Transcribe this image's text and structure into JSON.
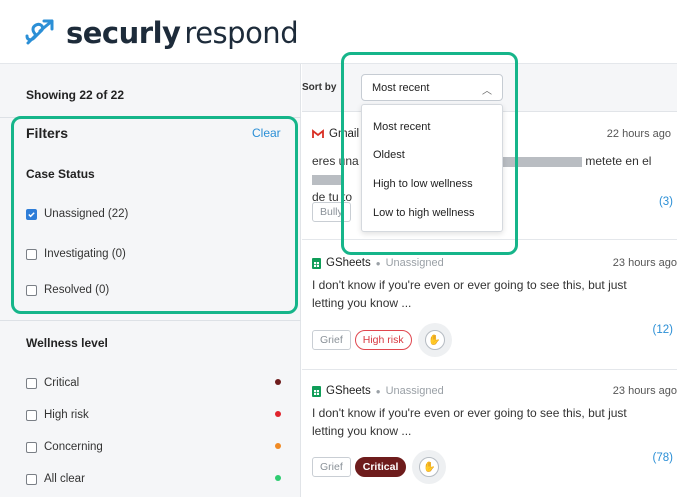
{
  "brand": {
    "word1": "securly",
    "word2": "respond"
  },
  "sidebar": {
    "showing": "Showing 22 of 22",
    "filters_title": "Filters",
    "clear": "Clear",
    "case_status_title": "Case Status",
    "case_status": [
      {
        "label": "Unassigned (22)",
        "checked": true
      },
      {
        "label": "Investigating (0)",
        "checked": false
      },
      {
        "label": "Resolved (0)",
        "checked": false
      }
    ],
    "wellness_title": "Wellness level",
    "wellness": [
      {
        "label": "Critical",
        "color": "#6e1c1c"
      },
      {
        "label": "High risk",
        "color": "#e0242d"
      },
      {
        "label": "Concerning",
        "color": "#f08a24"
      },
      {
        "label": "All clear",
        "color": "#2ecc71"
      }
    ]
  },
  "sort": {
    "label": "Sort by",
    "selected": "Most recent",
    "options": [
      "Most recent",
      "Oldest",
      "High to low wellness",
      "Low to high wellness"
    ]
  },
  "cards": [
    {
      "icon": "gmail-icon",
      "source": "Gmail",
      "time": "22 hours ago",
      "line1_start": "eres una",
      "line1_end": "metete en el",
      "line2": "de tu to",
      "tag": "Bully",
      "count": "(3)"
    },
    {
      "icon": "gsheets-icon",
      "source": "GSheets",
      "status": "Unassigned",
      "time": "23 hours ago",
      "text": "I don't know if you're even or ever going to see this, but just letting you know ...",
      "tags": [
        "Grief",
        "High risk"
      ],
      "count": "(12)"
    },
    {
      "icon": "gsheets-icon",
      "source": "GSheets",
      "status": "Unassigned",
      "time": "23 hours ago",
      "text": "I don't know if you're even or ever going to see this, but just letting you know ...",
      "tags": [
        "Grief",
        "Critical"
      ],
      "count": "(78)"
    }
  ],
  "colors": {
    "accent": "#2b8fd6",
    "highlight": "#16b58a",
    "critical": "#6e1c1c",
    "high_risk": "#e0474f"
  }
}
